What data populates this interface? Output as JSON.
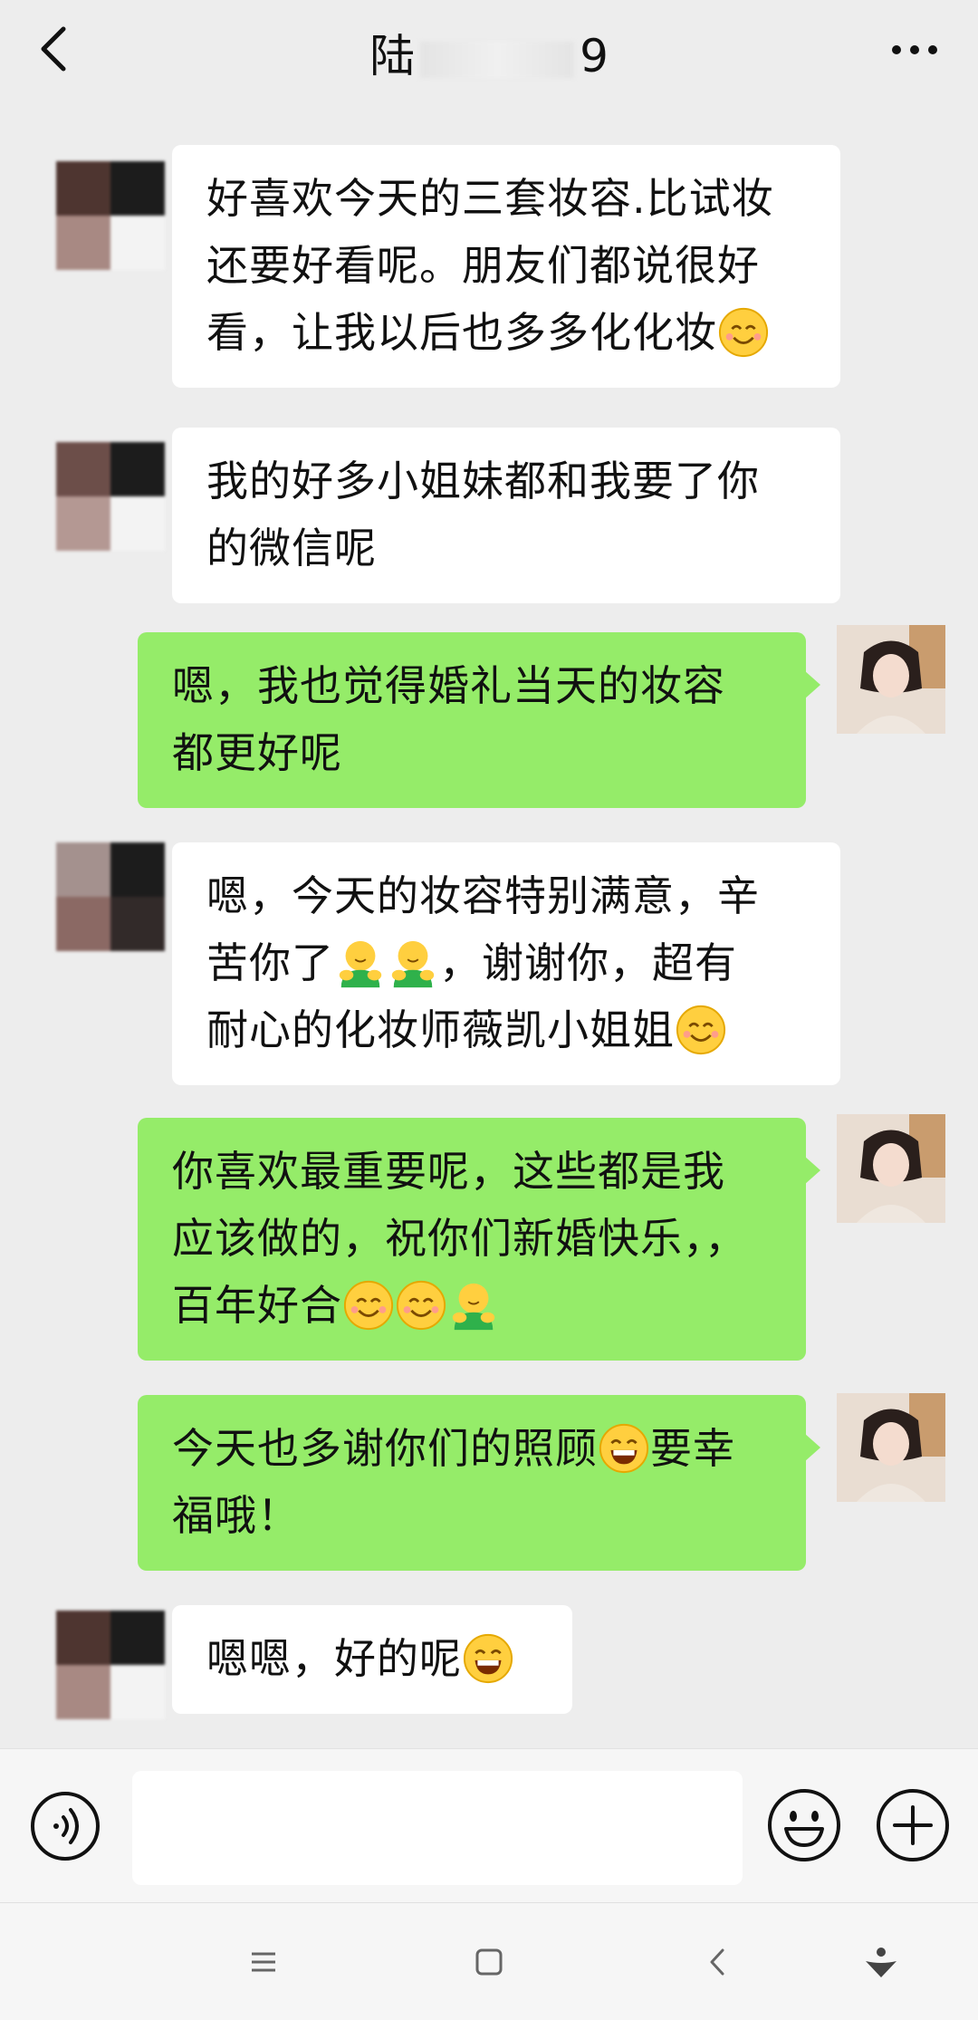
{
  "header": {
    "title_start": "陆",
    "title_end": "9",
    "back_icon": "chevron-left-icon",
    "more_icon": "more-dots-icon"
  },
  "messages": [
    {
      "side": "left",
      "text": "好喜欢今天的三套妆容.比试妆\n还要好看呢。朋友们都说很好\n看，让我以后也多多化化妆",
      "emojis": [
        "smile"
      ]
    },
    {
      "side": "left",
      "text": "我的好多小姐妹都和我要了你\n的微信呢",
      "emojis": []
    },
    {
      "side": "right",
      "text": "嗯，我也觉得婚礼当天的妆容\n都更好呢",
      "emojis": []
    },
    {
      "side": "left",
      "text_parts": [
        "嗯，今天的妆容特别满意，辛\n苦你了",
        "，谢谢你，超有\n耐心的化妆师薇凯小姐姐"
      ],
      "emojis": [
        "hug",
        "hug",
        "smile"
      ]
    },
    {
      "side": "right",
      "text": "你喜欢最重要呢，这些都是我\n应该做的，祝你们新婚快乐，，\n百年好合",
      "emojis": [
        "smile",
        "smile",
        "hug"
      ]
    },
    {
      "side": "right",
      "text_parts": [
        "今天也多谢你们的照顾",
        "要幸\n福哦！"
      ],
      "emojis": [
        "grin"
      ]
    },
    {
      "side": "left",
      "text": "嗯嗯，好的呢",
      "emojis": [
        "grin"
      ]
    }
  ],
  "input_bar": {
    "voice_icon": "voice-icon",
    "placeholder": "",
    "emoji_icon": "emoji-icon",
    "plus_icon": "plus-icon"
  },
  "nav_bar": {
    "icons": [
      "menu-icon",
      "home-square-icon",
      "back-chevron-icon",
      "assistant-icon"
    ]
  },
  "colors": {
    "background": "#ededed",
    "bubble_self": "#95ec69",
    "bubble_other": "#ffffff"
  }
}
